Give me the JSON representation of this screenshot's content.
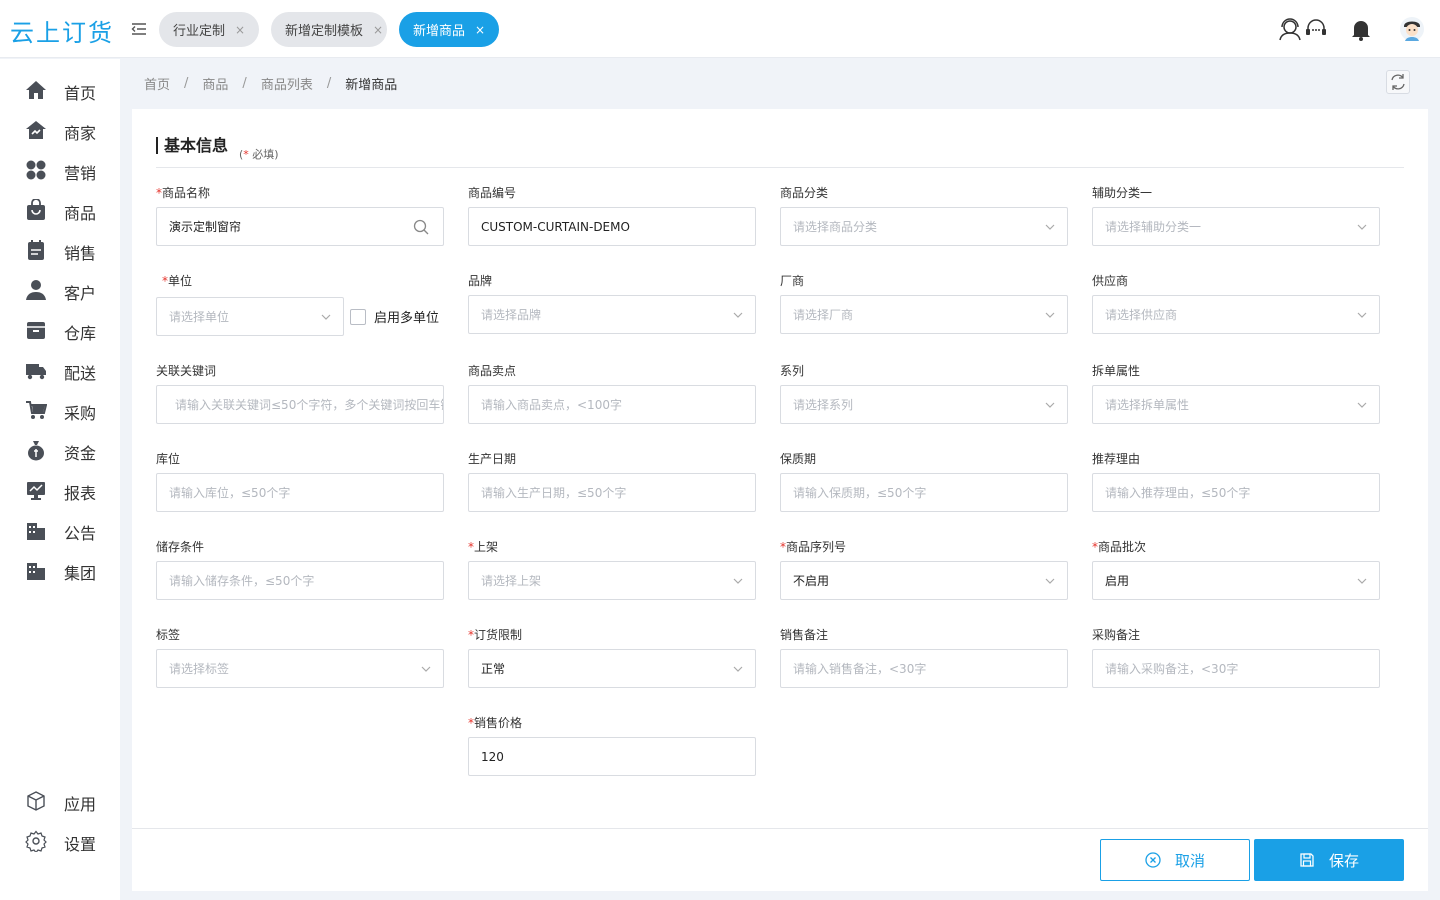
{
  "app": {
    "logo_text": "云上订货"
  },
  "tabs": [
    {
      "label": "行业定制",
      "close": "×",
      "active": false
    },
    {
      "label": "新增定制模板",
      "close": "×",
      "active": false
    },
    {
      "label": "新增商品",
      "close": "×",
      "active": true
    }
  ],
  "sidebar": {
    "items": [
      {
        "label": "首页",
        "icon": "home-icon"
      },
      {
        "label": "商家",
        "icon": "store-icon"
      },
      {
        "label": "营销",
        "icon": "marketing-icon"
      },
      {
        "label": "商品",
        "icon": "bag-icon"
      },
      {
        "label": "销售",
        "icon": "sales-icon"
      },
      {
        "label": "客户",
        "icon": "customer-icon"
      },
      {
        "label": "仓库",
        "icon": "warehouse-icon"
      },
      {
        "label": "配送",
        "icon": "truck-icon"
      },
      {
        "label": "采购",
        "icon": "cart-icon"
      },
      {
        "label": "资金",
        "icon": "money-bag-icon"
      },
      {
        "label": "报表",
        "icon": "report-icon"
      },
      {
        "label": "公告",
        "icon": "announcement-icon"
      },
      {
        "label": "集团",
        "icon": "group-icon"
      }
    ],
    "bottom_items": [
      {
        "label": "应用",
        "icon": "cube-icon"
      },
      {
        "label": "设置",
        "icon": "gear-icon"
      }
    ]
  },
  "breadcrumb": {
    "items": [
      "首页",
      "商品",
      "商品列表",
      "新增商品"
    ],
    "separator": "/"
  },
  "section": {
    "title": "基本信息",
    "note_star": "*",
    "note_open": "(",
    "note_text": " 必填)"
  },
  "form": {
    "product_name": {
      "label": "商品名称",
      "value": "演示定制窗帘",
      "required": true
    },
    "product_code": {
      "label": "商品编号",
      "value": "CUSTOM-CURTAIN-DEMO"
    },
    "category": {
      "label": "商品分类",
      "placeholder": "请选择商品分类"
    },
    "aux_category": {
      "label": "辅助分类一",
      "placeholder": "请选择辅助分类一"
    },
    "unit": {
      "label": "单位",
      "placeholder": "请选择单位",
      "required": true
    },
    "multi_unit": {
      "label": "启用多单位",
      "checked": false
    },
    "brand": {
      "label": "品牌",
      "placeholder": "请选择品牌"
    },
    "manufacturer": {
      "label": "厂商",
      "placeholder": "请选择厂商"
    },
    "supplier": {
      "label": "供应商",
      "placeholder": "请选择供应商"
    },
    "keywords": {
      "label": "关联关键词",
      "placeholder": "请输入关联关键词≤50个字符，多个关键词按回车键"
    },
    "selling_point": {
      "label": "商品卖点",
      "placeholder": "请输入商品卖点，<100字"
    },
    "series": {
      "label": "系列",
      "placeholder": "请选择系列"
    },
    "split_attr": {
      "label": "拆单属性",
      "placeholder": "请选择拆单属性"
    },
    "location": {
      "label": "库位",
      "placeholder": "请输入库位，≤50个字"
    },
    "production_date": {
      "label": "生产日期",
      "placeholder": "请输入生产日期，≤50个字"
    },
    "shelf_life": {
      "label": "保质期",
      "placeholder": "请输入保质期，≤50个字"
    },
    "recommend_reason": {
      "label": "推荐理由",
      "placeholder": "请输入推荐理由，≤50个字"
    },
    "storage": {
      "label": "储存条件",
      "placeholder": "请输入储存条件，≤50个字"
    },
    "listing": {
      "label": "上架",
      "placeholder": "请选择上架",
      "required": true
    },
    "serial_no": {
      "label": "商品序列号",
      "value": "不启用",
      "required": true
    },
    "batch": {
      "label": "商品批次",
      "value": "启用",
      "required": true
    },
    "tags": {
      "label": "标签",
      "placeholder": "请选择标签"
    },
    "order_limit": {
      "label": "订货限制",
      "value": "正常",
      "required": true
    },
    "sales_note": {
      "label": "销售备注",
      "placeholder": "请输入销售备注，<30字"
    },
    "purchase_note": {
      "label": "采购备注",
      "placeholder": "请输入采购备注，<30字"
    },
    "price": {
      "label": "销售价格",
      "value": "120",
      "required": true
    },
    "required_mark": "*"
  },
  "actions": {
    "cancel": "取消",
    "save": "保存"
  },
  "colors": {
    "accent": "#1aa0e6",
    "required": "#e5342c",
    "sidebar_icon": "#4a4f57"
  }
}
